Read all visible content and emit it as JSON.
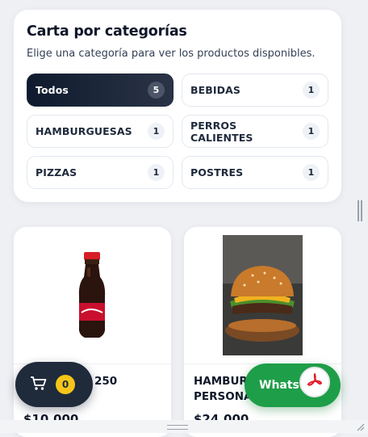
{
  "menu": {
    "title": "Carta por categorías",
    "subtitle": "Elige una categoría para ver los productos disponibles.",
    "categories": [
      {
        "label": "Todos",
        "count": "5",
        "active": true
      },
      {
        "label": "BEBIDAS",
        "count": "1",
        "active": false
      },
      {
        "label": "HAMBURGUESAS",
        "count": "1",
        "active": false
      },
      {
        "label": "PERROS CALIENTES",
        "count": "1",
        "active": false
      },
      {
        "label": "PIZZAS",
        "count": "1",
        "active": false
      },
      {
        "label": "POSTRES",
        "count": "1",
        "active": false
      }
    ]
  },
  "products": [
    {
      "name_line1": "250",
      "price": "$10.000",
      "image": "soda-bottle-image"
    },
    {
      "name_line1": "HAMBUR",
      "name_line2": "PERSONA",
      "price": "$24.000",
      "image": "burger-image"
    }
  ],
  "cart": {
    "count": "0",
    "icon": "cart-icon"
  },
  "whatsapp": {
    "label": "Whats..."
  },
  "pdf": {
    "icon": "pdf-icon"
  },
  "colors": {
    "active": "#0f1a2e",
    "cart_badge": "#f5c518",
    "whatsapp": "#1e9e48"
  }
}
